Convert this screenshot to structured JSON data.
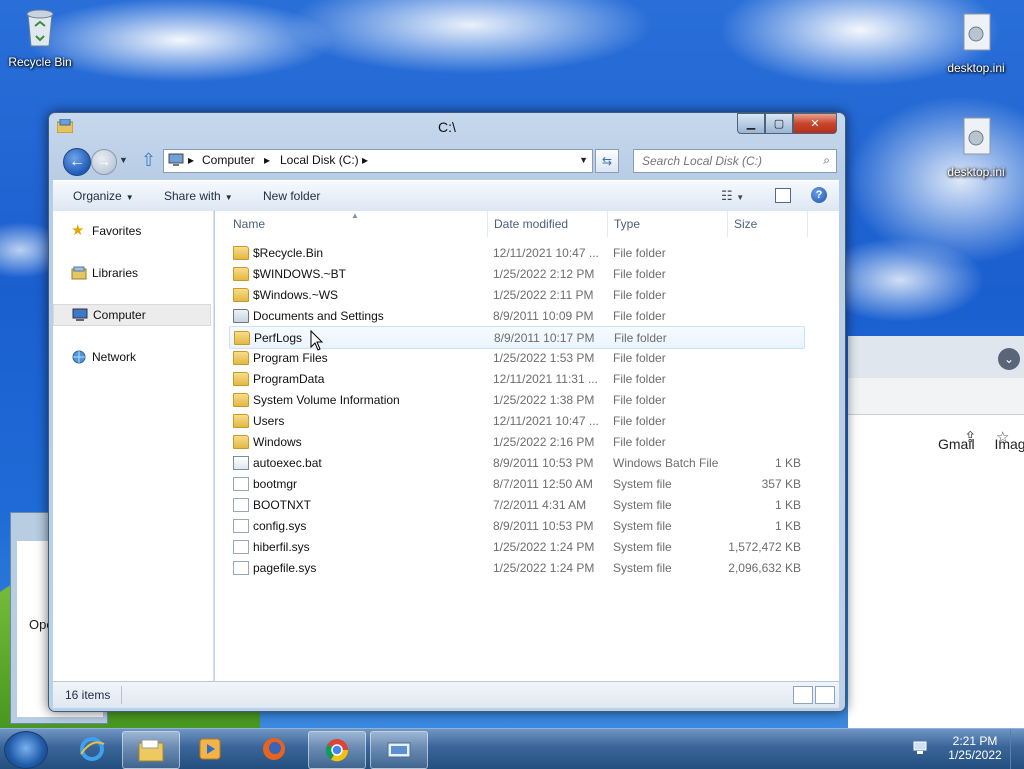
{
  "desktop": {
    "icons": [
      {
        "label": "Recycle Bin"
      },
      {
        "label": "desktop.ini"
      },
      {
        "label": "desktop.ini"
      }
    ]
  },
  "browser": {
    "links": [
      "Gmail",
      "Image"
    ],
    "partial_text": "Ope"
  },
  "explorer": {
    "title": "C:\\",
    "breadcrumb": [
      "Computer",
      "Local Disk (C:)"
    ],
    "search_placeholder": "Search Local Disk (C:)",
    "toolbar": {
      "organize": "Organize",
      "share_with": "Share with",
      "new_folder": "New folder"
    },
    "nav": [
      {
        "label": "Favorites",
        "icon": "star-icon"
      },
      {
        "label": "Libraries",
        "icon": "libraries-icon"
      },
      {
        "label": "Computer",
        "icon": "computer-icon",
        "selected": true
      },
      {
        "label": "Network",
        "icon": "network-icon"
      }
    ],
    "columns": {
      "name": "Name",
      "date": "Date modified",
      "type": "Type",
      "size": "Size"
    },
    "rows": [
      {
        "name": "$Recycle.Bin",
        "date": "12/11/2021 10:47 ...",
        "type": "File folder",
        "size": "",
        "kind": "folder"
      },
      {
        "name": "$WINDOWS.~BT",
        "date": "1/25/2022 2:12 PM",
        "type": "File folder",
        "size": "",
        "kind": "folder"
      },
      {
        "name": "$Windows.~WS",
        "date": "1/25/2022 2:11 PM",
        "type": "File folder",
        "size": "",
        "kind": "folder"
      },
      {
        "name": "Documents and Settings",
        "date": "8/9/2011 10:09 PM",
        "type": "File folder",
        "size": "",
        "kind": "shortcut"
      },
      {
        "name": "PerfLogs",
        "date": "8/9/2011 10:17 PM",
        "type": "File folder",
        "size": "",
        "kind": "folder",
        "hover": true
      },
      {
        "name": "Program Files",
        "date": "1/25/2022 1:53 PM",
        "type": "File folder",
        "size": "",
        "kind": "folder"
      },
      {
        "name": "ProgramData",
        "date": "12/11/2021 11:31 ...",
        "type": "File folder",
        "size": "",
        "kind": "folder"
      },
      {
        "name": "System Volume Information",
        "date": "1/25/2022 1:38 PM",
        "type": "File folder",
        "size": "",
        "kind": "folder"
      },
      {
        "name": "Users",
        "date": "12/11/2021 10:47 ...",
        "type": "File folder",
        "size": "",
        "kind": "folder"
      },
      {
        "name": "Windows",
        "date": "1/25/2022 2:16 PM",
        "type": "File folder",
        "size": "",
        "kind": "folder"
      },
      {
        "name": "autoexec.bat",
        "date": "8/9/2011 10:53 PM",
        "type": "Windows Batch File",
        "size": "1 KB",
        "kind": "bat"
      },
      {
        "name": "bootmgr",
        "date": "8/7/2011 12:50 AM",
        "type": "System file",
        "size": "357 KB",
        "kind": "file"
      },
      {
        "name": "BOOTNXT",
        "date": "7/2/2011 4:31 AM",
        "type": "System file",
        "size": "1 KB",
        "kind": "file"
      },
      {
        "name": "config.sys",
        "date": "8/9/2011 10:53 PM",
        "type": "System file",
        "size": "1 KB",
        "kind": "file"
      },
      {
        "name": "hiberfil.sys",
        "date": "1/25/2022 1:24 PM",
        "type": "System file",
        "size": "1,572,472 KB",
        "kind": "file"
      },
      {
        "name": "pagefile.sys",
        "date": "1/25/2022 1:24 PM",
        "type": "System file",
        "size": "2,096,632 KB",
        "kind": "file"
      }
    ],
    "status": {
      "item_count": "16 items"
    }
  },
  "taskbar": {
    "apps": [
      "internet-explorer-icon",
      "file-explorer-icon",
      "media-player-icon",
      "firefox-icon",
      "chrome-icon",
      "remote-desktop-icon"
    ],
    "clock": {
      "time": "2:21 PM",
      "date": "1/25/2022"
    }
  }
}
